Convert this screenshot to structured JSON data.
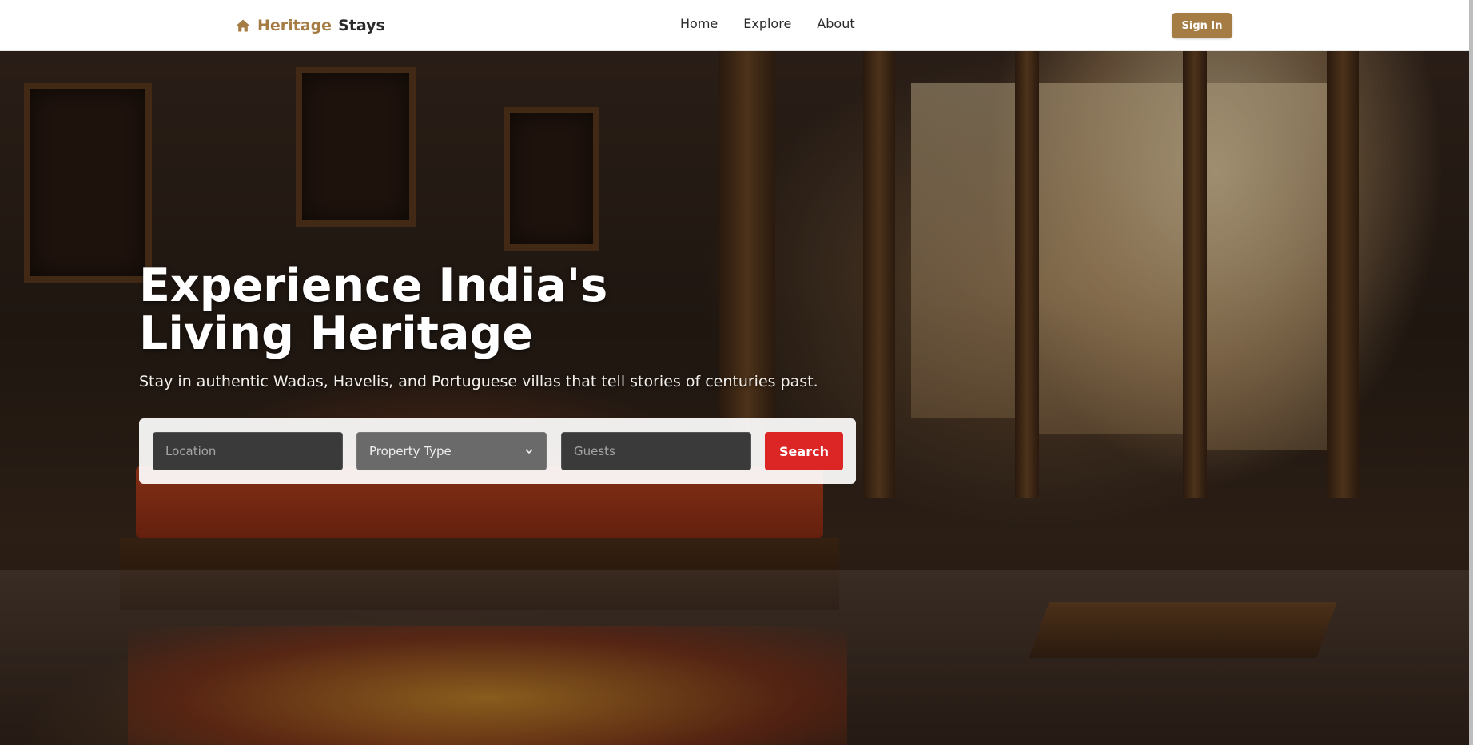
{
  "nav": {
    "brand_part1": "Heritage",
    "brand_part2": "Stays",
    "brand_icon": "home-icon",
    "links": [
      "Home",
      "Explore",
      "About"
    ],
    "signin_label": "Sign In"
  },
  "hero": {
    "title": "Experience India's Living Heritage",
    "subtitle": "Stay in authentic Wadas, Havelis, and Portuguese villas that tell stories of centuries past."
  },
  "search": {
    "location_placeholder": "Location",
    "property_type_selected": "Property Type",
    "guests_placeholder": "Guests",
    "button_label": "Search"
  },
  "colors": {
    "accent": "#a67c45",
    "search_button": "#dc2626"
  }
}
